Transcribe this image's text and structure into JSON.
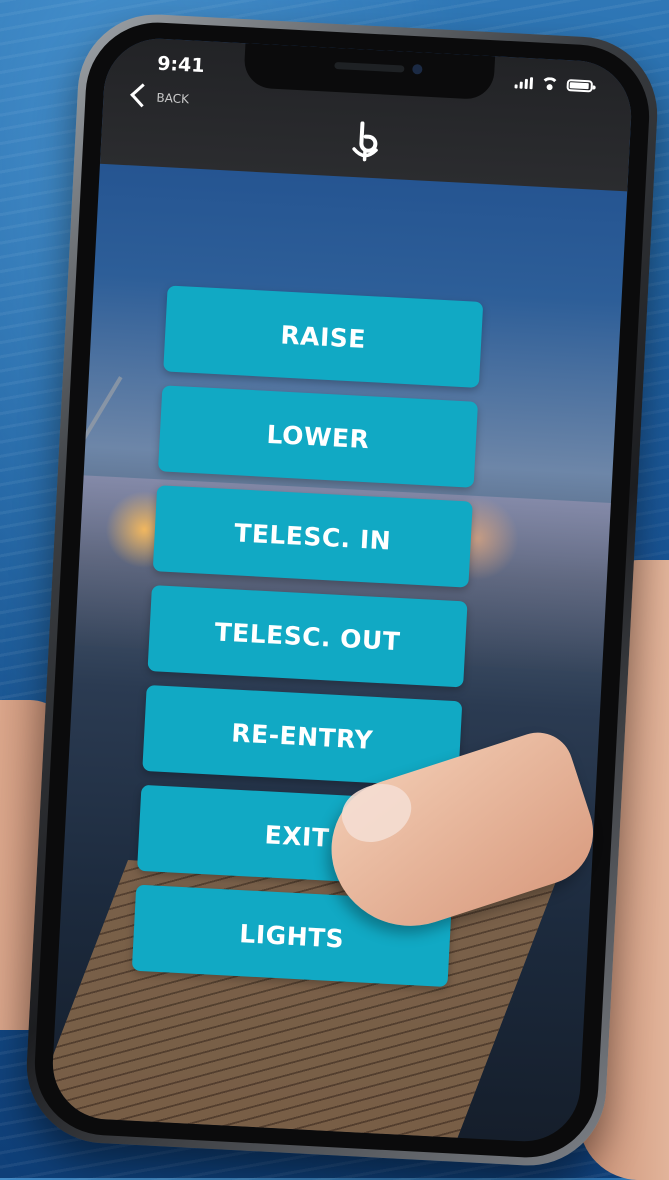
{
  "status_bar": {
    "time": "9:41"
  },
  "header": {
    "back_label": "BACK",
    "logo_icon": "anchor-logo-icon"
  },
  "controls": [
    {
      "id": "raise",
      "label": "RAISE"
    },
    {
      "id": "lower",
      "label": "LOWER"
    },
    {
      "id": "telesc-in",
      "label": "TELESC. IN"
    },
    {
      "id": "telesc-out",
      "label": "TELESC. OUT"
    },
    {
      "id": "re-entry",
      "label": "RE-ENTRY"
    },
    {
      "id": "exit",
      "label": "EXIT"
    },
    {
      "id": "lights",
      "label": "LIGHTS"
    }
  ],
  "colors": {
    "button": "#11a9c4",
    "header": "#222326",
    "text": "#ffffff"
  }
}
